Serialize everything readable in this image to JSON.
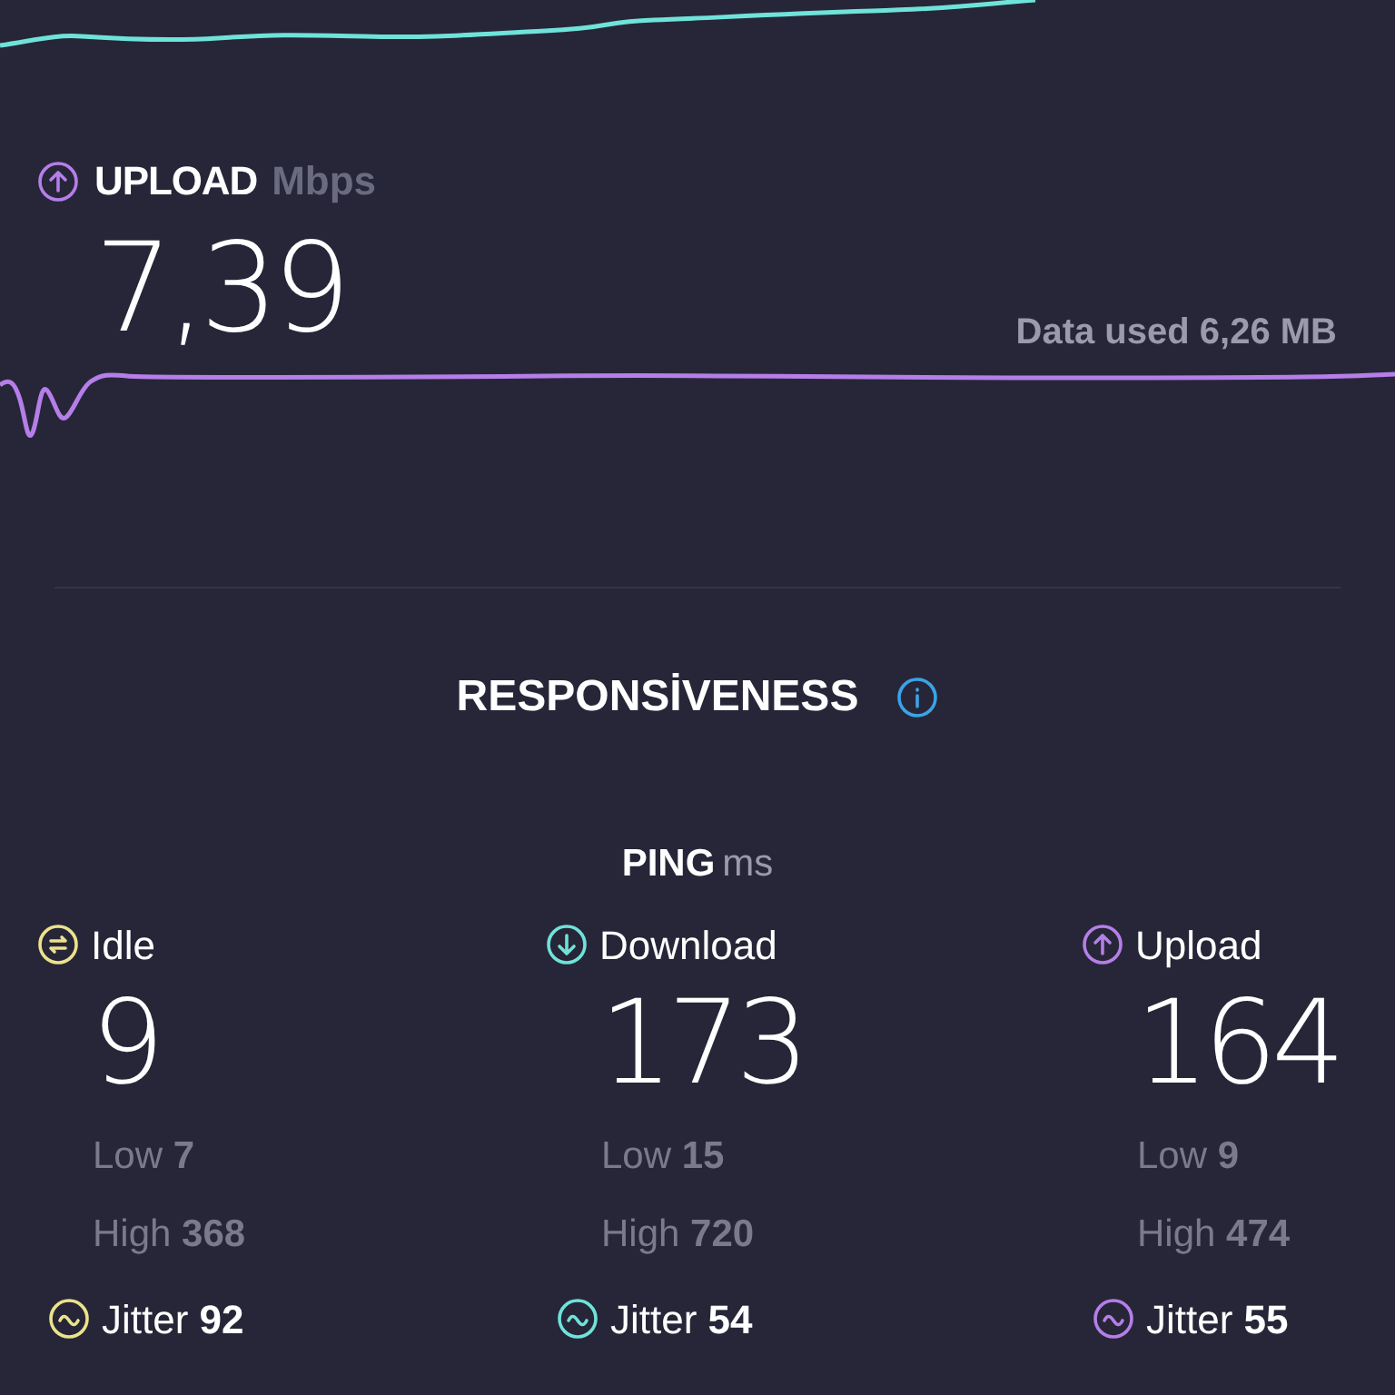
{
  "upload": {
    "label": "UPLOAD",
    "unit": "Mbps",
    "value": "7,39",
    "data_used": "Data used 6,26 MB"
  },
  "responsiveness": {
    "title": "RESPONSİVENESS"
  },
  "ping": {
    "label": "PING",
    "unit": "ms",
    "columns": [
      {
        "kind": "idle",
        "label": "Idle",
        "value": "9",
        "low": "Low **7**",
        "high": "High **368**",
        "jitter": "Jitter **92**",
        "color": "#ece28c"
      },
      {
        "kind": "download",
        "label": "Download",
        "value": "173",
        "low": "Low **15**",
        "high": "High **720**",
        "jitter": "Jitter **54**",
        "color": "#6fe3d9"
      },
      {
        "kind": "upload",
        "label": "Upload",
        "value": "164",
        "low": "Low **9**",
        "high": "High **474**",
        "jitter": "Jitter **55**",
        "color": "#b57ee8"
      }
    ]
  }
}
